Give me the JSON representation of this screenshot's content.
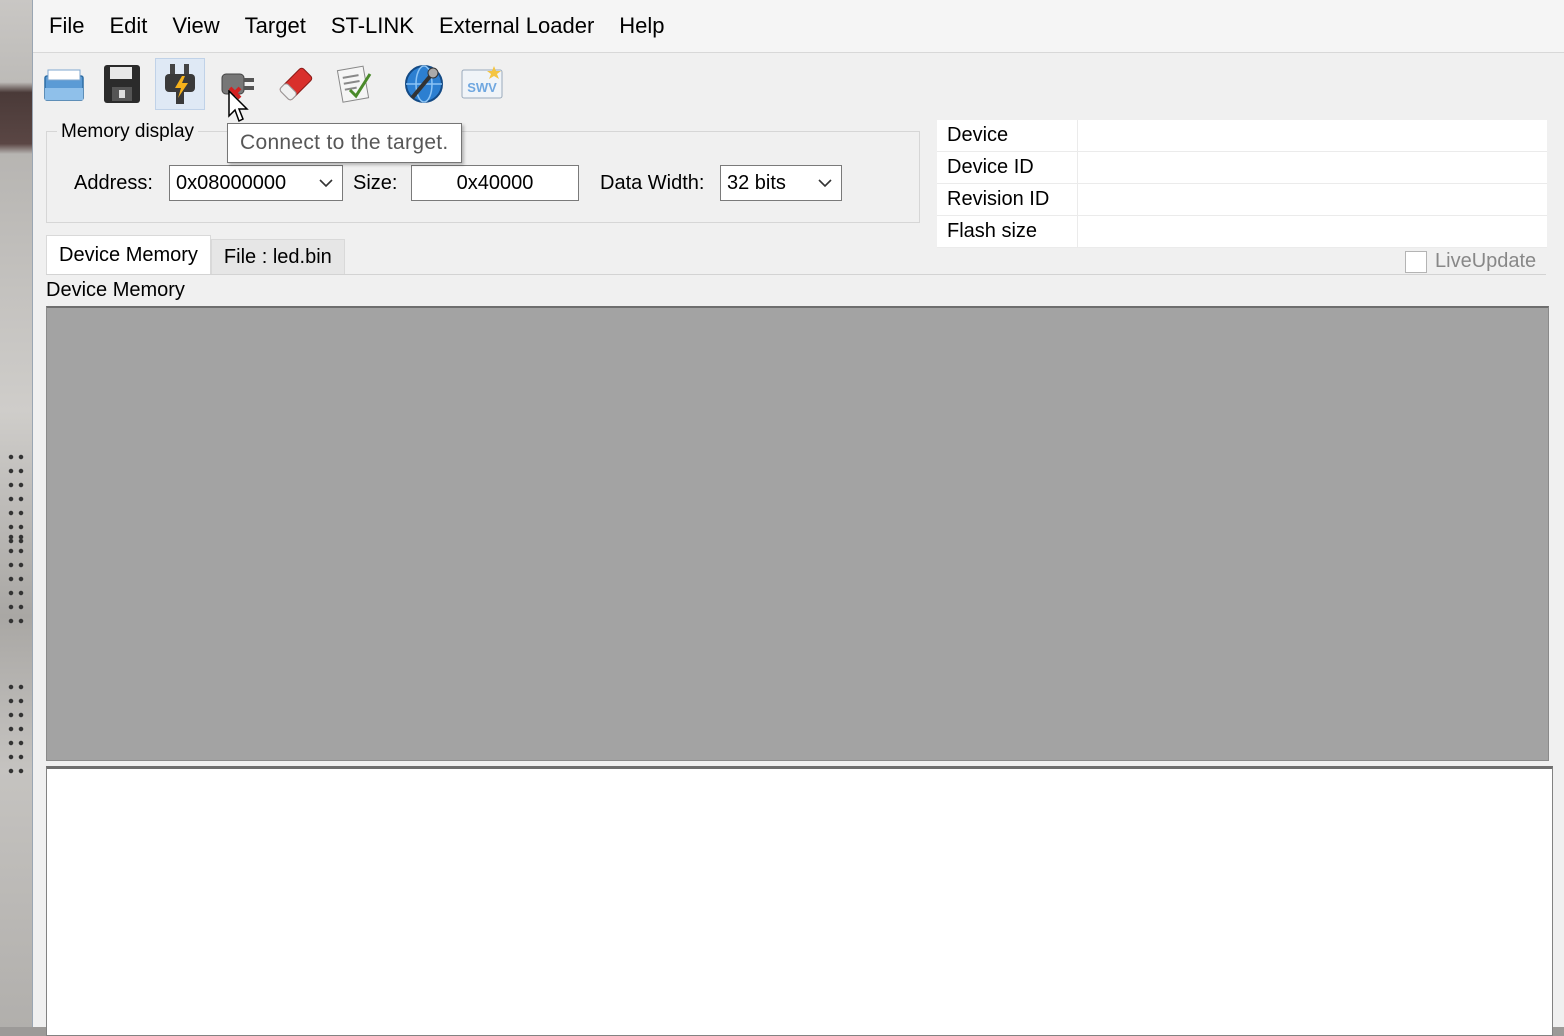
{
  "menu": [
    "File",
    "Edit",
    "View",
    "Target",
    "ST-LINK",
    "External Loader",
    "Help"
  ],
  "toolbar": {
    "icons": [
      "open-file-icon",
      "save-icon",
      "connect-icon",
      "disconnect-icon",
      "erase-icon",
      "program-verify-icon",
      "settings-globe-icon",
      "swv-icon"
    ],
    "swv_label": "SWV"
  },
  "tooltip": "Connect to the target.",
  "memory_display": {
    "title": "Memory display",
    "address_label": "Address:",
    "address_value": "0x08000000",
    "size_label": "Size:",
    "size_value": "0x40000",
    "data_width_label": "Data Width:",
    "data_width_value": "32 bits"
  },
  "device_info": [
    {
      "key": "Device",
      "value": ""
    },
    {
      "key": "Device ID",
      "value": ""
    },
    {
      "key": "Revision ID",
      "value": ""
    },
    {
      "key": "Flash size",
      "value": ""
    }
  ],
  "tabs": [
    "Device Memory",
    "File : led.bin"
  ],
  "live_update_label": "LiveUpdate",
  "device_memory_header": "Device Memory",
  "colors": {
    "memory_area": "#a3a3a3",
    "tooltip_text": "#575757"
  }
}
